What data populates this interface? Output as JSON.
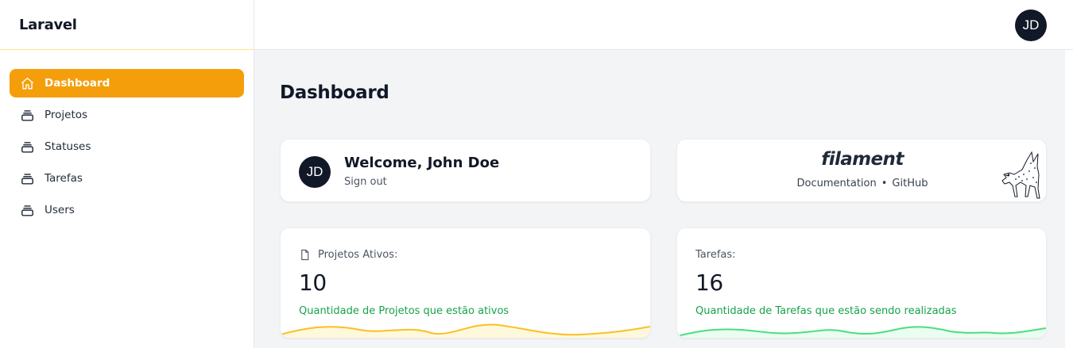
{
  "brand": "Laravel",
  "sidebar": {
    "items": [
      {
        "label": "Dashboard",
        "icon": "home-icon",
        "active": true
      },
      {
        "label": "Projetos",
        "icon": "collection-icon"
      },
      {
        "label": "Statuses",
        "icon": "collection-icon"
      },
      {
        "label": "Tarefas",
        "icon": "collection-icon"
      },
      {
        "label": "Users",
        "icon": "collection-icon"
      }
    ]
  },
  "topbar": {
    "avatar_initials": "JD"
  },
  "page": {
    "title": "Dashboard"
  },
  "welcome": {
    "avatar_initials": "JD",
    "greeting": "Welcome, John Doe",
    "signout": "Sign out"
  },
  "filament": {
    "logo": "filament",
    "docs_link": "Documentation",
    "separator": "•",
    "github_link": "GitHub"
  },
  "stats": [
    {
      "label": "Projetos Ativos:",
      "icon": "document-icon",
      "value": "10",
      "description": "Quantidade de Projetos que estão ativos",
      "chart_color": "#fbbf24"
    },
    {
      "label": "Tarefas:",
      "value": "16",
      "description": "Quantidade de Tarefas que estão sendo realizadas",
      "chart_color": "#4ade80"
    }
  ],
  "colors": {
    "accent": "#f59e0b",
    "success": "#16a34a",
    "avatar_bg": "#111827"
  }
}
